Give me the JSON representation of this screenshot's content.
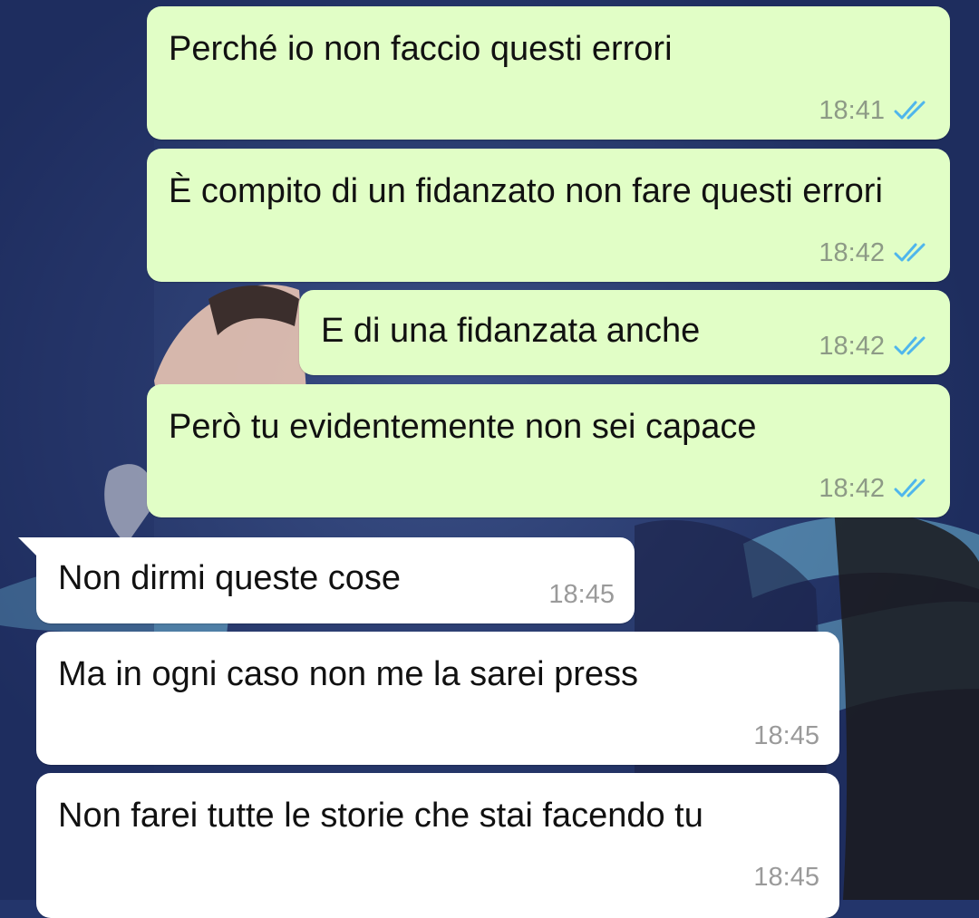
{
  "colors": {
    "wallpaper": "#23356b",
    "outgoing_bubble": "#e1fec6",
    "incoming_bubble": "#ffffff",
    "read_ticks": "#4fb6ec",
    "timestamp_outgoing": "#8d9a86",
    "timestamp_incoming": "#9a9a9a"
  },
  "messages": [
    {
      "direction": "outgoing",
      "text": "Perché io non faccio questi errori",
      "time": "18:41",
      "status": "read",
      "status_icon": "double-check-icon"
    },
    {
      "direction": "outgoing",
      "text": "È compito di un fidanzato non fare questi errori",
      "time": "18:42",
      "status": "read",
      "status_icon": "double-check-icon"
    },
    {
      "direction": "outgoing",
      "text": "E di una fidanzata anche",
      "time": "18:42",
      "status": "read",
      "status_icon": "double-check-icon"
    },
    {
      "direction": "outgoing",
      "text": "Però tu evidentemente non sei capace",
      "time": "18:42",
      "status": "read",
      "status_icon": "double-check-icon"
    },
    {
      "direction": "incoming",
      "text": "Non dirmi queste cose",
      "time": "18:45"
    },
    {
      "direction": "incoming",
      "text": "Ma in ogni caso non me la sarei press",
      "time": "18:45"
    },
    {
      "direction": "incoming",
      "text": "Non farei tutte le storie che stai facendo tu",
      "time": "18:45"
    }
  ]
}
